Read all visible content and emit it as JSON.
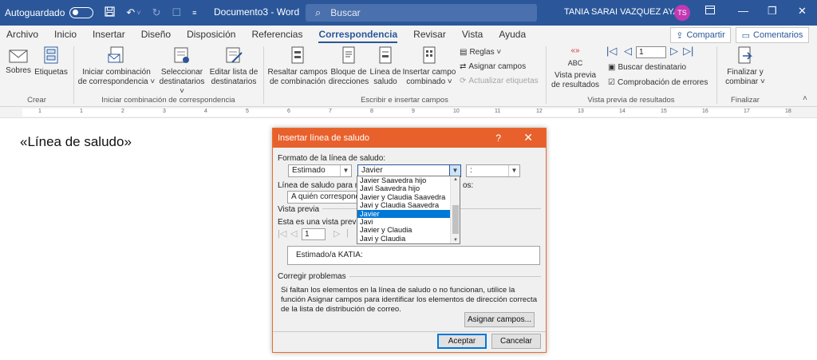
{
  "titlebar": {
    "autosave_label": "Autoguardado",
    "doc_title": "Documento3  -  Word",
    "search_placeholder": "Buscar",
    "user_name": "TANIA SARAI VAZQUEZ AYALA",
    "avatar_initials": "TS",
    "accent_color": "#2b579a"
  },
  "tabs": [
    {
      "label": "Archivo"
    },
    {
      "label": "Inicio"
    },
    {
      "label": "Insertar"
    },
    {
      "label": "Diseño"
    },
    {
      "label": "Disposición"
    },
    {
      "label": "Referencias"
    },
    {
      "label": "Correspondencia",
      "active": true
    },
    {
      "label": "Revisar"
    },
    {
      "label": "Vista"
    },
    {
      "label": "Ayuda"
    }
  ],
  "share_label": "Compartir",
  "comments_label": "Comentarios",
  "ribbon": {
    "crear": {
      "label": "Crear",
      "sobres": "Sobres",
      "etiquetas": "Etiquetas"
    },
    "iniciar": {
      "label": "Iniciar combinación de correspondencia",
      "iniciar_l1": "Iniciar combinación",
      "iniciar_l2": "de correspondencia ˅",
      "seleccionar_l1": "Seleccionar",
      "seleccionar_l2": "destinatarios ˅",
      "editar_l1": "Editar lista de",
      "editar_l2": "destinatarios"
    },
    "escribir": {
      "label": "Escribir e insertar campos",
      "resaltar_l1": "Resaltar campos",
      "resaltar_l2": "de combinación",
      "bloque_l1": "Bloque de",
      "bloque_l2": "direcciones",
      "linea_l1": "Línea de",
      "linea_l2": "saludo",
      "insertar_l1": "Insertar campo",
      "insertar_l2": "combinado ˅",
      "reglas": "Reglas ˅",
      "asignar": "Asignar campos",
      "actualizar": "Actualizar etiquetas"
    },
    "vista_previa": {
      "label": "Vista previa de resultados",
      "abc": "ABC",
      "vista_l1": "Vista previa",
      "vista_l2": "de resultados",
      "record": "1",
      "buscar": "Buscar destinatario",
      "comprobacion": "Comprobación de errores"
    },
    "finalizar": {
      "label": "Finalizar",
      "fin_l1": "Finalizar y",
      "fin_l2": "combinar ˅"
    }
  },
  "ruler_numbers": [
    "1",
    "1",
    "2",
    "3",
    "4",
    "5",
    "6",
    "7",
    "8",
    "9",
    "10",
    "11",
    "12",
    "13",
    "14",
    "15",
    "16",
    "17",
    "18"
  ],
  "document": {
    "merge_field": "«Línea de saludo»"
  },
  "dialog": {
    "title": "Insertar línea de saludo",
    "help": "?",
    "close": "✕",
    "format_label": "Formato de la línea de saludo:",
    "salutation_value": "Estimado",
    "name_value": "Javier",
    "punct_value": ":",
    "invalid_label": "Línea de saludo para no",
    "invalid_label_tail": "os:",
    "invalid_value": "A quién correspond",
    "preview_section": "Vista previa",
    "preview_label": "Esta es una vista previa d",
    "record": "1",
    "preview_text": "Estimado/a KATIA:",
    "fix_section": "Corregir problemas",
    "fix_text": "Si faltan los elementos en la línea de saludo o no funcionan, utilice la función Asignar campos para identificar los elementos de dirección correcta de la lista de distribución de correo.",
    "assign_button": "Asignar campos...",
    "ok_button": "Aceptar",
    "cancel_button": "Cancelar"
  },
  "dropdown": {
    "items": [
      {
        "label": "Javier Saavedra hijo"
      },
      {
        "label": "Javi Saavedra hijo"
      },
      {
        "label": "Javier y Claudia Saavedra"
      },
      {
        "label": "Javi y Claudia Saavedra"
      },
      {
        "label": "Javier",
        "selected": true
      },
      {
        "label": "Javi"
      },
      {
        "label": "Javier y Claudia"
      },
      {
        "label": "Javi y Claudia"
      }
    ]
  }
}
